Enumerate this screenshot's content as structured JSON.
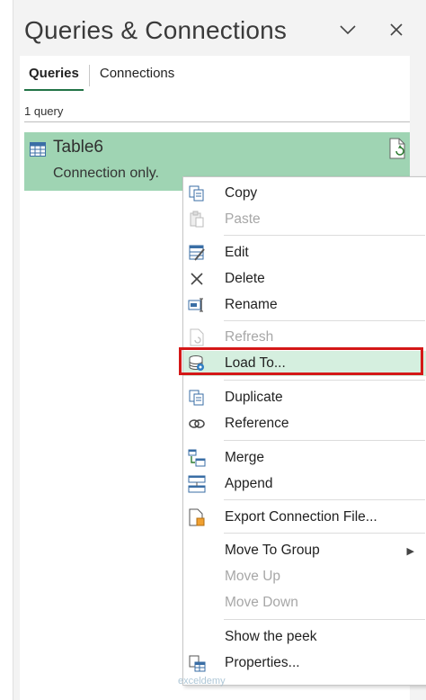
{
  "pane": {
    "title": "Queries & Connections",
    "collapse_icon": "chevron-down-icon",
    "close_icon": "close-icon"
  },
  "tabs": [
    {
      "label": "Queries",
      "active": true
    },
    {
      "label": "Connections",
      "active": false
    }
  ],
  "query_count": "1 query",
  "query": {
    "name": "Table6",
    "status": "Connection only.",
    "icon": "table-icon",
    "side_icon": "refresh-document-icon"
  },
  "context_menu": {
    "items": [
      {
        "label": "Copy",
        "icon": "copy-icon",
        "enabled": true
      },
      {
        "label": "Paste",
        "icon": "paste-icon",
        "enabled": false
      },
      {
        "label": "Edit",
        "icon": "edit-icon",
        "enabled": true
      },
      {
        "label": "Delete",
        "icon": "delete-icon",
        "enabled": true
      },
      {
        "label": "Rename",
        "icon": "rename-icon",
        "enabled": true
      },
      {
        "label": "Refresh",
        "icon": "refresh-icon",
        "enabled": false
      },
      {
        "label": "Load To...",
        "icon": "load-to-icon",
        "enabled": true,
        "selected": true
      },
      {
        "label": "Duplicate",
        "icon": "duplicate-icon",
        "enabled": true
      },
      {
        "label": "Reference",
        "icon": "reference-icon",
        "enabled": true
      },
      {
        "label": "Merge",
        "icon": "merge-icon",
        "enabled": true
      },
      {
        "label": "Append",
        "icon": "append-icon",
        "enabled": true
      },
      {
        "label": "Export Connection File...",
        "icon": "export-file-icon",
        "enabled": true
      },
      {
        "label": "Move To Group",
        "icon": "",
        "enabled": true,
        "submenu": true
      },
      {
        "label": "Move Up",
        "icon": "",
        "enabled": false
      },
      {
        "label": "Move Down",
        "icon": "",
        "enabled": false
      },
      {
        "label": "Show the peek",
        "icon": "",
        "enabled": true
      },
      {
        "label": "Properties...",
        "icon": "properties-icon",
        "enabled": true
      }
    ],
    "submenu_arrow": "▶"
  },
  "colors": {
    "accent": "#217346",
    "query_selected_bg": "#9fd4b3",
    "menu_selected_bg": "#d5efdf",
    "highlight_border": "#d41818"
  },
  "watermark": "exceldemy"
}
